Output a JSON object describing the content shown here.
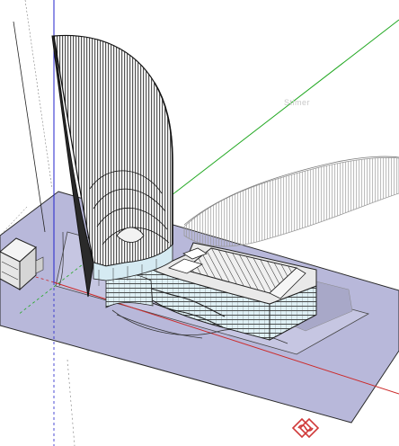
{
  "viewport": {
    "watermark_text": "Stimer",
    "colors": {
      "background": "#ffffff",
      "ground_plane": "#b4b4d6",
      "site_slab": "#c3c3df",
      "axis_red": "#cc2a2a",
      "axis_green": "#22a822",
      "axis_blue": "#2222cc",
      "edge": "#1a1a1a",
      "shadow": "#9a9a9a",
      "glass": "#c9e4ee",
      "logo": "#d03a3a"
    },
    "icons": {
      "logo": "diamond-swirl-logo-icon"
    }
  }
}
